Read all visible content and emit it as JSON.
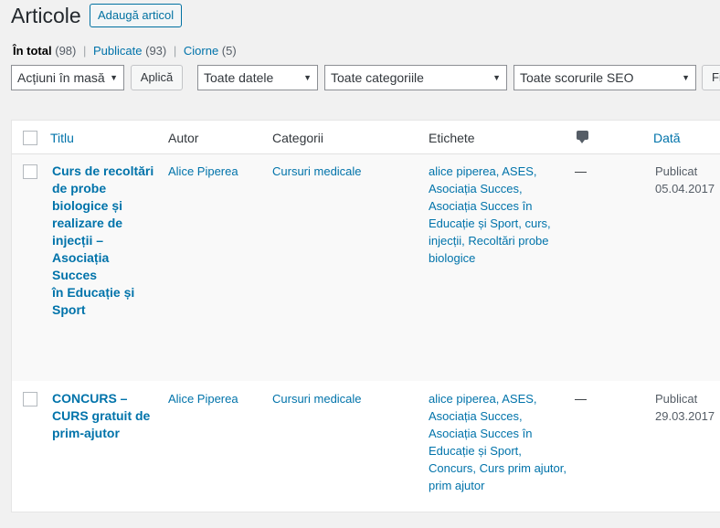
{
  "page": {
    "title": "Articole",
    "add_new": "Adaugă articol"
  },
  "views": {
    "all_label": "În total",
    "all_count": "(98)",
    "published_label": "Publicate",
    "published_count": "(93)",
    "drafts_label": "Ciorne",
    "drafts_count": "(5)",
    "separator": "|"
  },
  "filters": {
    "bulk_actions": "Acțiuni în masă",
    "apply": "Aplică",
    "dates": "Toate datele",
    "categories": "Toate categoriile",
    "seo_scores": "Toate scorurile SEO",
    "filter_btn": "Fi"
  },
  "table": {
    "columns": {
      "title": "Titlu",
      "author": "Autor",
      "categories": "Categorii",
      "tags": "Etichete",
      "date": "Dată"
    },
    "rows": [
      {
        "title_lines": [
          "Curs de recoltări",
          "de probe",
          "biologice și",
          "realizare de",
          "injecții –",
          "Asociația Succes",
          "în Educație și",
          "Sport"
        ],
        "author": "Alice Piperea",
        "category": "Cursuri medicale",
        "tag_lines": [
          "alice piperea, ASES,",
          "Asociația Succes,",
          "Asociația Succes în",
          "Educație și Sport, curs,",
          "injecții, Recoltări probe",
          "biologice"
        ],
        "comments": "—",
        "status": "Publicat",
        "date": "05.04.2017"
      },
      {
        "title_lines": [
          "CONCURS –",
          "CURS gratuit de",
          "prim-ajutor"
        ],
        "author": "Alice Piperea",
        "category": "Cursuri medicale",
        "tag_lines": [
          "alice piperea, ASES,",
          "Asociația Succes,",
          "Asociația Succes în",
          "Educație și Sport,",
          "Concurs, Curs prim ajutor,",
          "prim ajutor"
        ],
        "comments": "—",
        "status": "Publicat",
        "date": "29.03.2017"
      }
    ]
  }
}
